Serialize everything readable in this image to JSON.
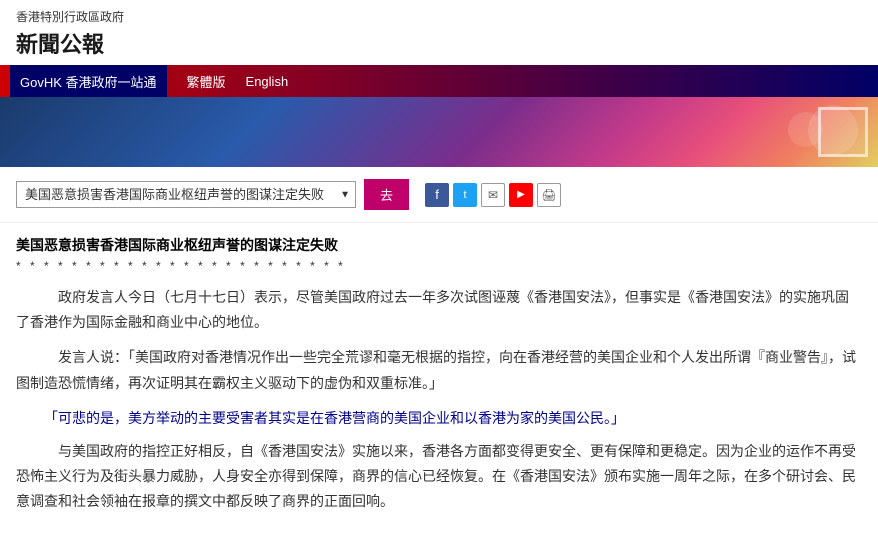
{
  "header": {
    "gov_label": "香港特別行政區政府",
    "title": "新聞公報"
  },
  "nav": {
    "govhk_label": "GovHK 香港政府一站通",
    "trad_label": "繁體版",
    "eng_label": "English"
  },
  "search": {
    "select_value": "美国恶意损害香港国际商业枢纽声誉的图谋注定失败",
    "go_label": "去"
  },
  "social": {
    "fb": "f",
    "tw": "t",
    "mail": "✉",
    "yt": "▶",
    "print": "🖨"
  },
  "article": {
    "title_text": "美国恶意损害香港国际商业枢纽声誉的图谋注定失败",
    "stars": "* * * * * * * * * * * * * * * * * * * * * * * *",
    "para1": "政府发言人今日（七月十七日）表示，尽管美国政府过去一年多次试图诬蔑《香港国安法》，但事实是《香港国安法》的实施巩固了香港作为国际金融和商业中心的地位。",
    "para2": "发言人说：「美国政府对香港情况作出一些完全荒谬和毫无根据的指控，向在香港经营的美国企业和个人发出所谓『商业警告』，试图制造恐慌情绪，再次证明其在霸权主义驱动下的虚伪和双重标准。」",
    "para3_quote": "「可悲的是，美方举动的主要受害者其实是在香港营商的美国企业和以香港为家的美国公民。」",
    "para4": "与美国政府的指控正好相反，自《香港国安法》实施以来，香港各方面都变得更安全、更有保障和更稳定。因为企业的运作不再受恐怖主义行为及街头暴力威胁，人身安全亦得到保障，商界的信心已经恢复。在《香港国安法》颁布实施一周年之际，在多个研讨会、民意调查和社会领袖在报章的撰文中都反映了商界的正面回响。"
  }
}
